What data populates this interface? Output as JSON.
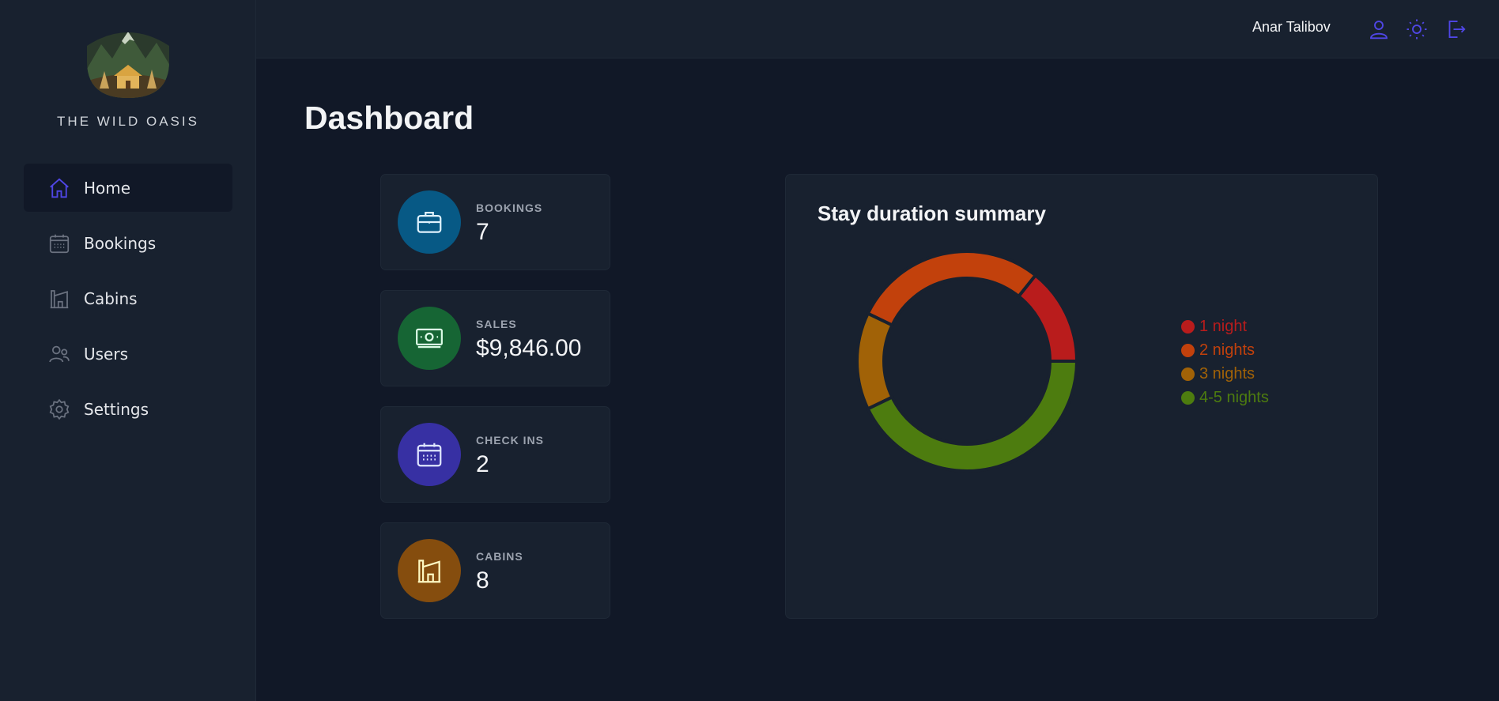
{
  "sidebar": {
    "brand": "THE WILD OASIS",
    "items": [
      {
        "label": "Home",
        "icon": "home-icon",
        "active": true
      },
      {
        "label": "Bookings",
        "icon": "calendar-icon",
        "active": false
      },
      {
        "label": "Cabins",
        "icon": "building-icon",
        "active": false
      },
      {
        "label": "Users",
        "icon": "users-icon",
        "active": false
      },
      {
        "label": "Settings",
        "icon": "gear-icon",
        "active": false
      }
    ]
  },
  "header": {
    "user_name": "Anar Talibov",
    "buttons": [
      "user-icon",
      "sun-icon",
      "logout-icon"
    ]
  },
  "main": {
    "title": "Dashboard",
    "stats": [
      {
        "label": "BOOKINGS",
        "value": "7",
        "icon": "briefcase-icon",
        "color": "#075985"
      },
      {
        "label": "SALES",
        "value": "$9,846.00",
        "icon": "banknotes-icon",
        "color": "#166534"
      },
      {
        "label": "CHECK INS",
        "value": "2",
        "icon": "calendar-days-icon",
        "color": "#3730a3"
      },
      {
        "label": "CABINS",
        "value": "8",
        "icon": "building-icon",
        "color": "#854d0e"
      }
    ]
  },
  "colors": {
    "accent": "#4f46e5",
    "sidebar_bg": "#18212f",
    "page_bg": "#111827"
  },
  "chart_data": {
    "type": "pie",
    "title": "Stay duration summary",
    "series": [
      {
        "name": "1 night",
        "value": 1,
        "color": "#b91c1c"
      },
      {
        "name": "2 nights",
        "value": 2,
        "color": "#c2410c"
      },
      {
        "name": "3 nights",
        "value": 1,
        "color": "#a16207"
      },
      {
        "name": "4-5 nights",
        "value": 3,
        "color": "#4d7c0f"
      }
    ],
    "legend": "right"
  }
}
